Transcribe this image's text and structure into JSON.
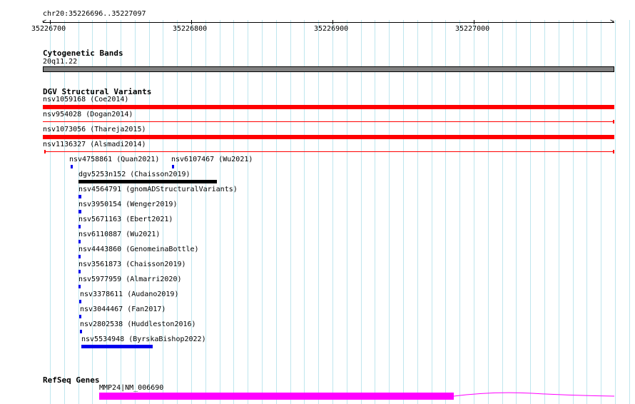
{
  "ruler": {
    "region": "chr20:35226696..35227097",
    "ticks": [
      "35226700",
      "35226800",
      "35226900",
      "35227000"
    ]
  },
  "cytobands": {
    "title": "Cytogenetic Bands",
    "band": "20q11.22"
  },
  "dgv": {
    "title": "DGV Structural Variants",
    "variants": [
      "nsv1059168 (Coe2014)",
      "nsv954028 (Dogan2014)",
      "nsv1073056 (Thareja2015)",
      "nsv1136327 (Alsmadi2014)",
      "nsv4758861 (Quan2021)",
      "nsv6107467 (Wu2021)",
      "dgv5253n152 (Chaisson2019)",
      "nsv4564791 (gnomADStructuralVariants)",
      "nsv3950154 (Wenger2019)",
      "nsv5671163 (Ebert2021)",
      "nsv6110887 (Wu2021)",
      "nsv4443860 (GenomeinaBottle)",
      "nsv3561873 (Chaisson2019)",
      "nsv5977959 (Almarri2020)",
      "nsv3378611 (Audano2019)",
      "nsv3044467 (Fan2017)",
      "nsv2802538 (Huddleston2016)",
      "nsv5534948 (ByrskaBishop2022)"
    ]
  },
  "refseq": {
    "title": "RefSeq Genes",
    "gene": "MMP24|NM_006690"
  },
  "colors": {
    "grid": "#bfe6ee",
    "band": "#808080",
    "red": "#ff0000",
    "black": "#000000",
    "blue": "#0000ee",
    "magenta": "#ff00ff"
  }
}
